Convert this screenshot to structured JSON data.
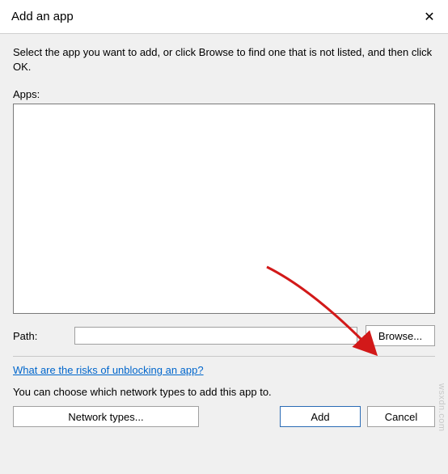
{
  "titlebar": {
    "title": "Add an app",
    "close_glyph": "✕"
  },
  "description": "Select the app you want to add, or click Browse to find one that is not listed, and then click OK.",
  "apps_label": "Apps:",
  "path": {
    "label": "Path:",
    "value": "",
    "browse_label": "Browse..."
  },
  "risks_link_label": "What are the risks of unblocking an app?",
  "network_desc": "You can choose which network types to add this app to.",
  "buttons": {
    "network_types": "Network types...",
    "add": "Add",
    "cancel": "Cancel"
  },
  "watermark": "wsxdn.com"
}
